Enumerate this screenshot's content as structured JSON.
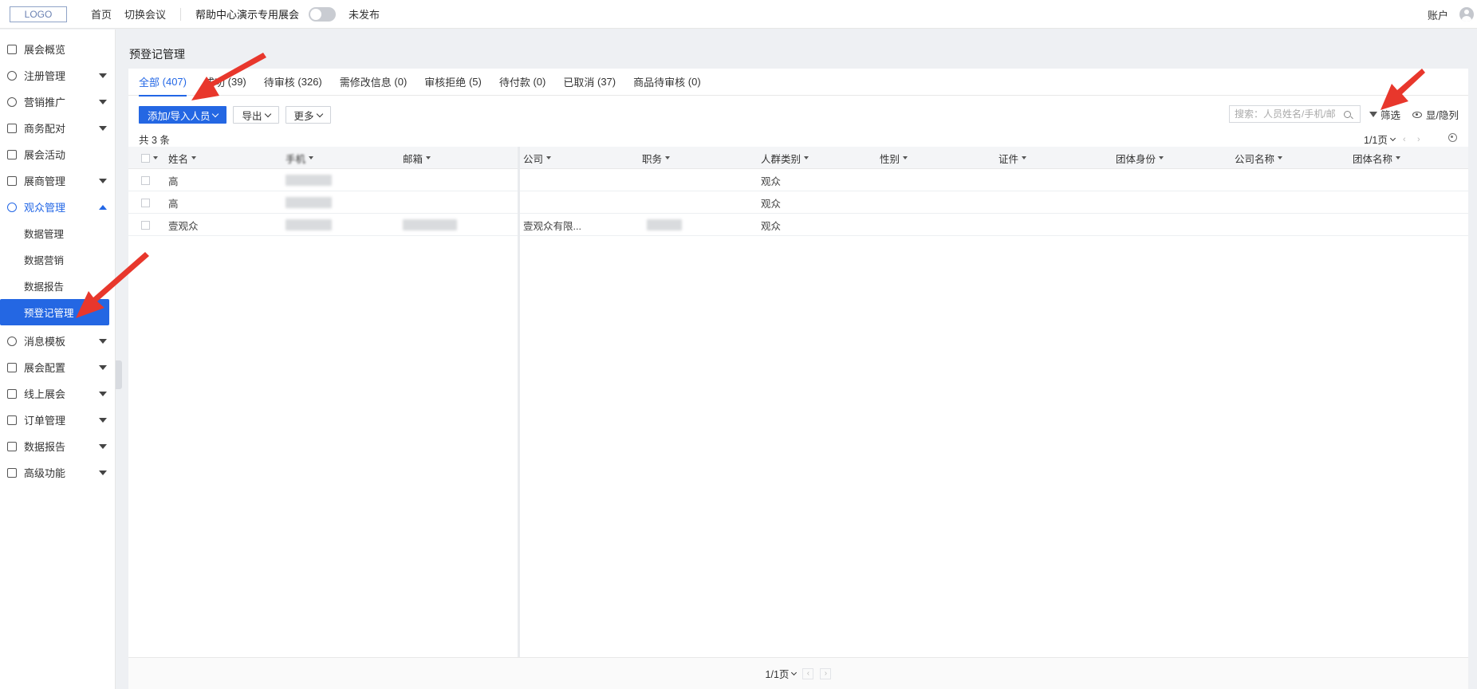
{
  "topbar": {
    "logo": "LOGO",
    "nav": [
      "首页",
      "切换会议"
    ],
    "event_name": "帮助中心演示专用展会",
    "publish_status": "未发布",
    "account": "账户"
  },
  "sidebar": {
    "items": [
      {
        "label": "展会概览",
        "icon": "dashboard-icon",
        "caret": ""
      },
      {
        "label": "注册管理",
        "icon": "user-icon",
        "caret": "down"
      },
      {
        "label": "营销推广",
        "icon": "clock-icon",
        "caret": "down"
      },
      {
        "label": "商务配对",
        "icon": "handshake-icon",
        "caret": "down"
      },
      {
        "label": "展会活动",
        "icon": "calendar-icon",
        "caret": ""
      },
      {
        "label": "展商管理",
        "icon": "store-icon",
        "caret": "down"
      },
      {
        "label": "观众管理",
        "icon": "database-icon",
        "caret": "up",
        "active_group": true
      }
    ],
    "sub_items": [
      {
        "label": "数据管理"
      },
      {
        "label": "数据营销"
      },
      {
        "label": "数据报告"
      },
      {
        "label": "预登记管理",
        "active": true
      }
    ],
    "items_after": [
      {
        "label": "消息模板",
        "icon": "bell-icon"
      },
      {
        "label": "展会配置",
        "icon": "settings-icon"
      },
      {
        "label": "线上展会",
        "icon": "monitor-icon"
      },
      {
        "label": "订单管理",
        "icon": "order-icon"
      },
      {
        "label": "数据报告",
        "icon": "chart-icon"
      },
      {
        "label": "高级功能",
        "icon": "grid-icon"
      }
    ]
  },
  "page": {
    "title": "预登记管理",
    "tabs": [
      {
        "label": "全部",
        "count": "(407)",
        "active": true
      },
      {
        "label": "成功",
        "count": "(39)"
      },
      {
        "label": "待审核",
        "count": "(326)"
      },
      {
        "label": "需修改信息",
        "count": "(0)"
      },
      {
        "label": "审核拒绝",
        "count": "(5)"
      },
      {
        "label": "待付款",
        "count": "(0)"
      },
      {
        "label": "已取消",
        "count": "(37)"
      },
      {
        "label": "商品待审核",
        "count": "(0)"
      }
    ],
    "toolbar": {
      "add_import": "添加/导入人员",
      "export": "导出",
      "more": "更多"
    },
    "search_placeholder": "搜索：人员姓名/手机/邮",
    "filter": "筛选",
    "show_hide_cols": "显/隐列",
    "total": "共 3 条",
    "page_indicator": "1/1页"
  },
  "table": {
    "columns": [
      "姓名",
      "手机",
      "邮箱",
      "公司",
      "职务",
      "人群类别",
      "性别",
      "证件",
      "团体身份",
      "公司名称",
      "团体名称"
    ],
    "rows": [
      {
        "name": "高",
        "company": "",
        "category": "观众",
        "email_blur": false,
        "title_blur": false
      },
      {
        "name": "高",
        "company": "",
        "category": "观众",
        "email_blur": false,
        "title_blur": false
      },
      {
        "name": "壹观众",
        "company": "壹观众有限...",
        "category": "观众",
        "email_blur": true,
        "title_blur": true
      }
    ]
  },
  "colors": {
    "primary": "#2467e3",
    "annotation_arrow": "#e8372c"
  }
}
